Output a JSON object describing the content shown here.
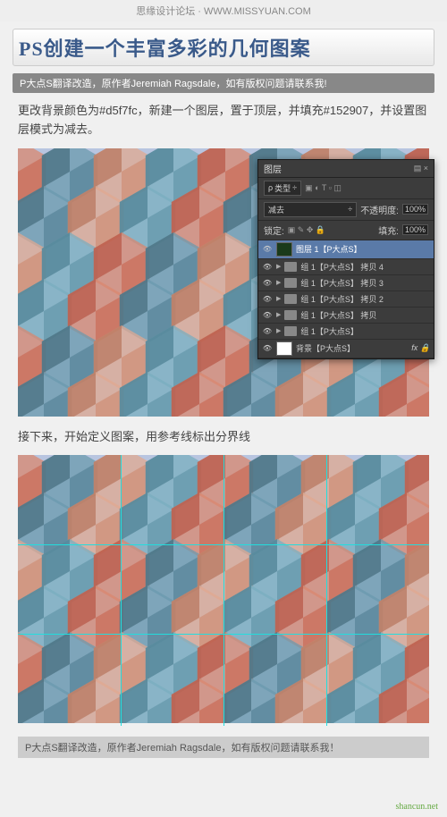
{
  "brand": "思缘设计论坛 · WWW.MISSYUAN.COM",
  "title": "PS创建一个丰富多彩的几何图案",
  "credit": "P大点S翻译改造，原作者Jeremiah Ragsdale，如有版权问题请联系我!",
  "para1": "更改背景颜色为#d5f7fc，新建一个图层，置于顶层，并填充#152907，并设置图层模式为减去。",
  "para2": "接下来，开始定义图案，用参考线标出分界线",
  "footer_credit": "P大点S翻译改造，原作者Jeremiah Ragsdale，如有版权问题请联系我！",
  "watermark": "shancun.net",
  "layers_panel": {
    "tab": "图层",
    "kind_label": "类型",
    "blend_mode": "减去",
    "opacity_label": "不透明度:",
    "opacity_value": "100%",
    "lock_label": "锁定:",
    "fill_label": "填充:",
    "fill_value": "100%",
    "layers": [
      {
        "name": "图层 1【P大点S】",
        "type": "layer",
        "active": true
      },
      {
        "name": "组 1【P大点S】 拷贝 4",
        "type": "group"
      },
      {
        "name": "组 1【P大点S】 拷贝 3",
        "type": "group"
      },
      {
        "name": "组 1【P大点S】 拷贝 2",
        "type": "group"
      },
      {
        "name": "组 1【P大点S】 拷贝",
        "type": "group"
      },
      {
        "name": "组 1【P大点S】",
        "type": "group"
      },
      {
        "name": "背景【P大点S】",
        "type": "bg"
      }
    ],
    "fx": "fx"
  }
}
